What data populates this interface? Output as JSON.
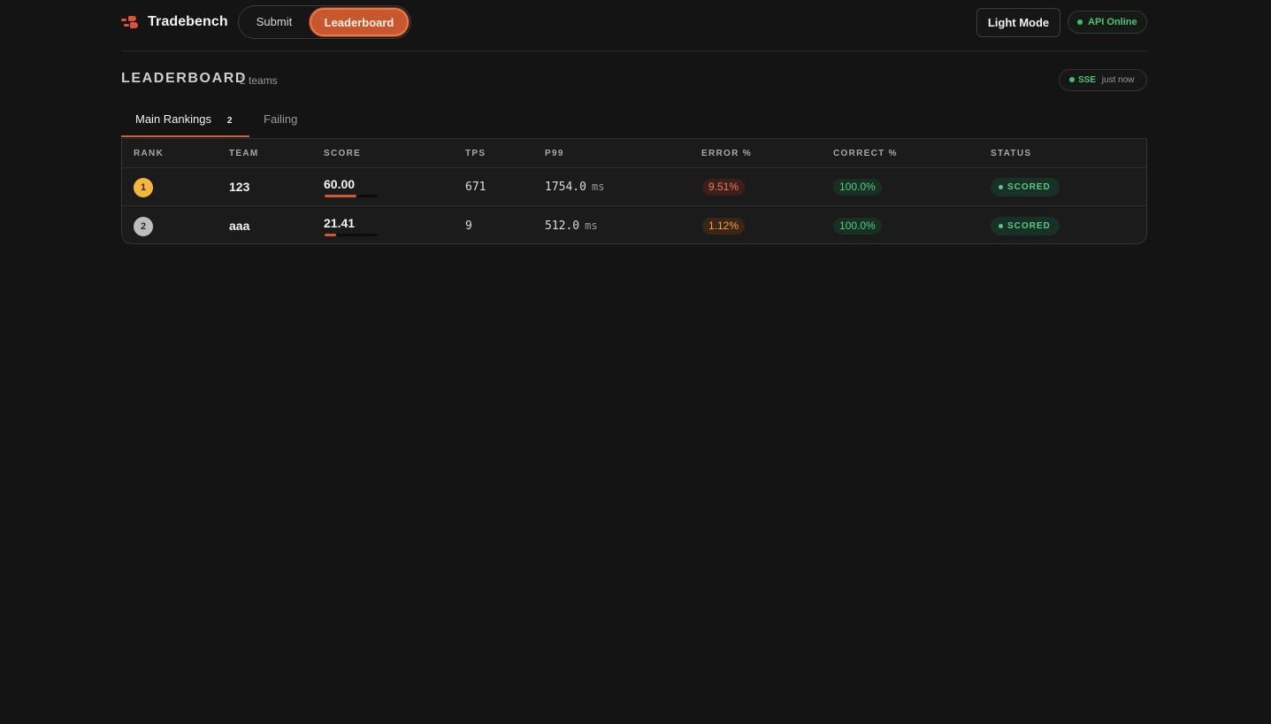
{
  "header": {
    "brand": "Tradebench",
    "nav": [
      {
        "label": "Submit"
      },
      {
        "label": "Leaderboard",
        "active": true
      }
    ],
    "theme_toggle": "Light Mode",
    "api_status": "API Online"
  },
  "section": {
    "title": "LEADERBOARD",
    "count": "2 teams",
    "sse": {
      "label": "SSE",
      "time": "just now"
    }
  },
  "tabs": [
    {
      "label": "Main Rankings",
      "count": "2",
      "active": true
    },
    {
      "label": "Failing"
    }
  ],
  "table": {
    "columns": [
      "RANK",
      "TEAM",
      "SCORE",
      "TPS",
      "P99",
      "ERROR %",
      "CORRECT %",
      "STATUS"
    ],
    "rows": [
      {
        "rank": "1",
        "team": "123",
        "score": "60.00",
        "score_fraction": 0.6,
        "tps": "671",
        "p99": "1754.0",
        "p99_unit": "ms",
        "error": "9.51%",
        "correct": "100.0%",
        "status": "SCORED"
      },
      {
        "rank": "2",
        "team": "aaa",
        "score": "21.41",
        "score_fraction": 0.2141,
        "tps": "9",
        "p99": "512.0",
        "p99_unit": "ms",
        "error": "1.12%",
        "correct": "100.0%",
        "status": "SCORED"
      }
    ]
  },
  "colors": {
    "background": "#141414",
    "accent": "#c7582e",
    "success": "#4fc27a",
    "rank1": "#f6b63c",
    "rank2": "#bdbdbd",
    "error_high": "#f07a5a",
    "error_low": "#f3a04f"
  },
  "icons": {
    "brand": "tradebench-logo-icon",
    "status_dot": "status-dot-icon"
  }
}
